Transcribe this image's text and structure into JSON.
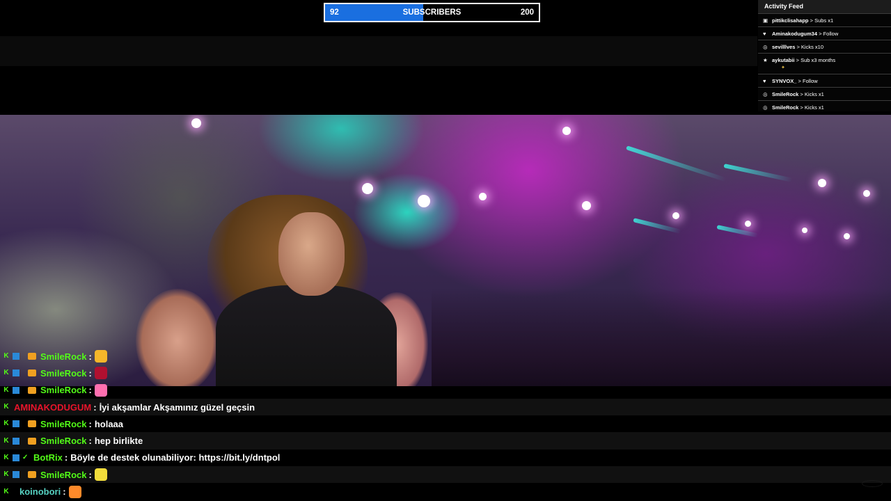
{
  "colors": {
    "goal_fill": "#1a6fe0",
    "kick_green": "#53fc18",
    "username_smilerock": "#53fc18",
    "username_aminakodugum": "#e8142b",
    "username_botrix": "#53fc18",
    "username_koinobori": "#56d2c2"
  },
  "goal": {
    "current": "92",
    "label": "SUBSCRIBERS",
    "target": "200",
    "progress_fraction": 0.46
  },
  "activity_feed": {
    "title": "Activity Feed",
    "items": [
      {
        "icon": "gift-icon",
        "user": "pittikclisahapp",
        "action": " > Subs x1",
        "emote": ""
      },
      {
        "icon": "heart-icon",
        "user": "Aminakodugum34",
        "action": " > Follow",
        "emote": ""
      },
      {
        "icon": "kick-coin-icon",
        "user": "sevilllves",
        "action": " > Kicks x10",
        "emote": ""
      },
      {
        "icon": "star-icon",
        "user": "aykutabii",
        "action": " > Sub x3 months",
        "emote": "emote"
      },
      {
        "icon": "heart-icon",
        "user": "SYNVOX_",
        "action": " > Follow",
        "emote": ""
      },
      {
        "icon": "kick-coin-icon",
        "user": "SmileRock",
        "action": " > Kicks x1",
        "emote": ""
      },
      {
        "icon": "kick-coin-icon",
        "user": "SmileRock",
        "action": " > Kicks x1",
        "emote": ""
      }
    ]
  },
  "chat": {
    "separator": ":",
    "messages": [
      {
        "user": "SmileRock",
        "text": "",
        "emote": "hand-emote",
        "badges": [
          "kick-badge-icon",
          "prime-badge-icon",
          "dot",
          "crown-badge-icon"
        ]
      },
      {
        "user": "SmileRock",
        "text": "",
        "emote": "red-emote",
        "badges": [
          "kick-badge-icon",
          "prime-badge-icon",
          "dot",
          "crown-badge-icon"
        ]
      },
      {
        "user": "SmileRock",
        "text": "",
        "emote": "pink-emote",
        "badges": [
          "kick-badge-icon",
          "prime-badge-icon",
          "dot",
          "crown-badge-icon"
        ]
      },
      {
        "user": "AMINAKODUGUM",
        "text": "İyi akşamlar Akşamınız güzel geçsin",
        "emote": "",
        "badges": [
          "kick-badge-icon"
        ]
      },
      {
        "user": "SmileRock",
        "text": "holaaa",
        "emote": "",
        "badges": [
          "kick-badge-icon",
          "prime-badge-icon",
          "dot",
          "crown-badge-icon"
        ]
      },
      {
        "user": "SmileRock",
        "text": "hep birlikte",
        "emote": "",
        "badges": [
          "kick-badge-icon",
          "prime-badge-icon",
          "dot",
          "crown-badge-icon"
        ]
      },
      {
        "user": "BotRix",
        "text": "Böyle de destek olunabiliyor: https://bit.ly/dntpol",
        "emote": "",
        "badges": [
          "kick-badge-icon",
          "prime-badge-icon",
          "verified-badge-icon"
        ]
      },
      {
        "user": "SmileRock",
        "text": "",
        "emote": "yellow-emote",
        "badges": [
          "kick-badge-icon",
          "prime-badge-icon",
          "dot",
          "crown-badge-icon"
        ]
      },
      {
        "user": "koinobori",
        "text": "",
        "emote": "orange-emote",
        "badges": [
          "kick-badge-icon",
          "dot"
        ]
      }
    ]
  }
}
